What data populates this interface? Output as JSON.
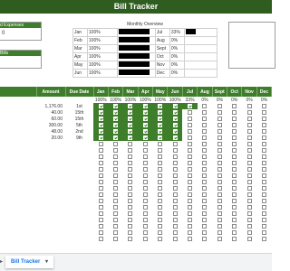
{
  "title": "Bill Tracker",
  "left_panel": {
    "expenses_header": "d Expenses",
    "expenses_value": "0",
    "bills_header": "Bills"
  },
  "monthly_overview": {
    "title": "Monthly Overview",
    "left": [
      {
        "month": "Jan",
        "pct": "100%"
      },
      {
        "month": "Feb",
        "pct": "100%"
      },
      {
        "month": "Mar",
        "pct": "100%"
      },
      {
        "month": "Apr",
        "pct": "100%"
      },
      {
        "month": "May",
        "pct": "100%"
      },
      {
        "month": "Jun",
        "pct": "100%"
      }
    ],
    "right": [
      {
        "month": "Jul",
        "pct": "33%",
        "fill": 0.33
      },
      {
        "month": "Aug",
        "pct": "0%",
        "fill": 0
      },
      {
        "month": "Sept",
        "pct": "0%",
        "fill": 0
      },
      {
        "month": "Oct",
        "pct": "0%",
        "fill": 0
      },
      {
        "month": "Nov",
        "pct": "0%",
        "fill": 0
      },
      {
        "month": "Dec",
        "pct": "0%",
        "fill": 0
      }
    ]
  },
  "grid": {
    "headers": {
      "amount": "Amount",
      "due": "Due Date"
    },
    "months": [
      "Jan",
      "Feb",
      "Mar",
      "Apr",
      "May",
      "Jun",
      "Jul",
      "Aug",
      "Sept",
      "Oct",
      "Nov",
      "Dec"
    ],
    "percents": [
      "100%",
      "100%",
      "100%",
      "100%",
      "100%",
      "100%",
      "33%",
      "0%",
      "0%",
      "0%",
      "0%",
      "0%"
    ],
    "rows": [
      {
        "amount": "1,176.00",
        "due": "1st",
        "checked": 7
      },
      {
        "amount": "40.00",
        "due": "15th",
        "checked": 6
      },
      {
        "amount": "60.00",
        "due": "15th",
        "checked": 6
      },
      {
        "amount": "300.00",
        "due": "5th",
        "checked": 6
      },
      {
        "amount": "48.00",
        "due": "2nd",
        "checked": 6
      },
      {
        "amount": "20.00",
        "due": "9th",
        "checked": 6
      }
    ],
    "empty_rows": 16
  },
  "sheet_tab": {
    "label": "Bill Tracker",
    "arrow": "▾"
  },
  "colors": {
    "header_dark": "#2e5d1f",
    "header": "#3e7d2a",
    "accent_blue": "#1a73e8"
  }
}
